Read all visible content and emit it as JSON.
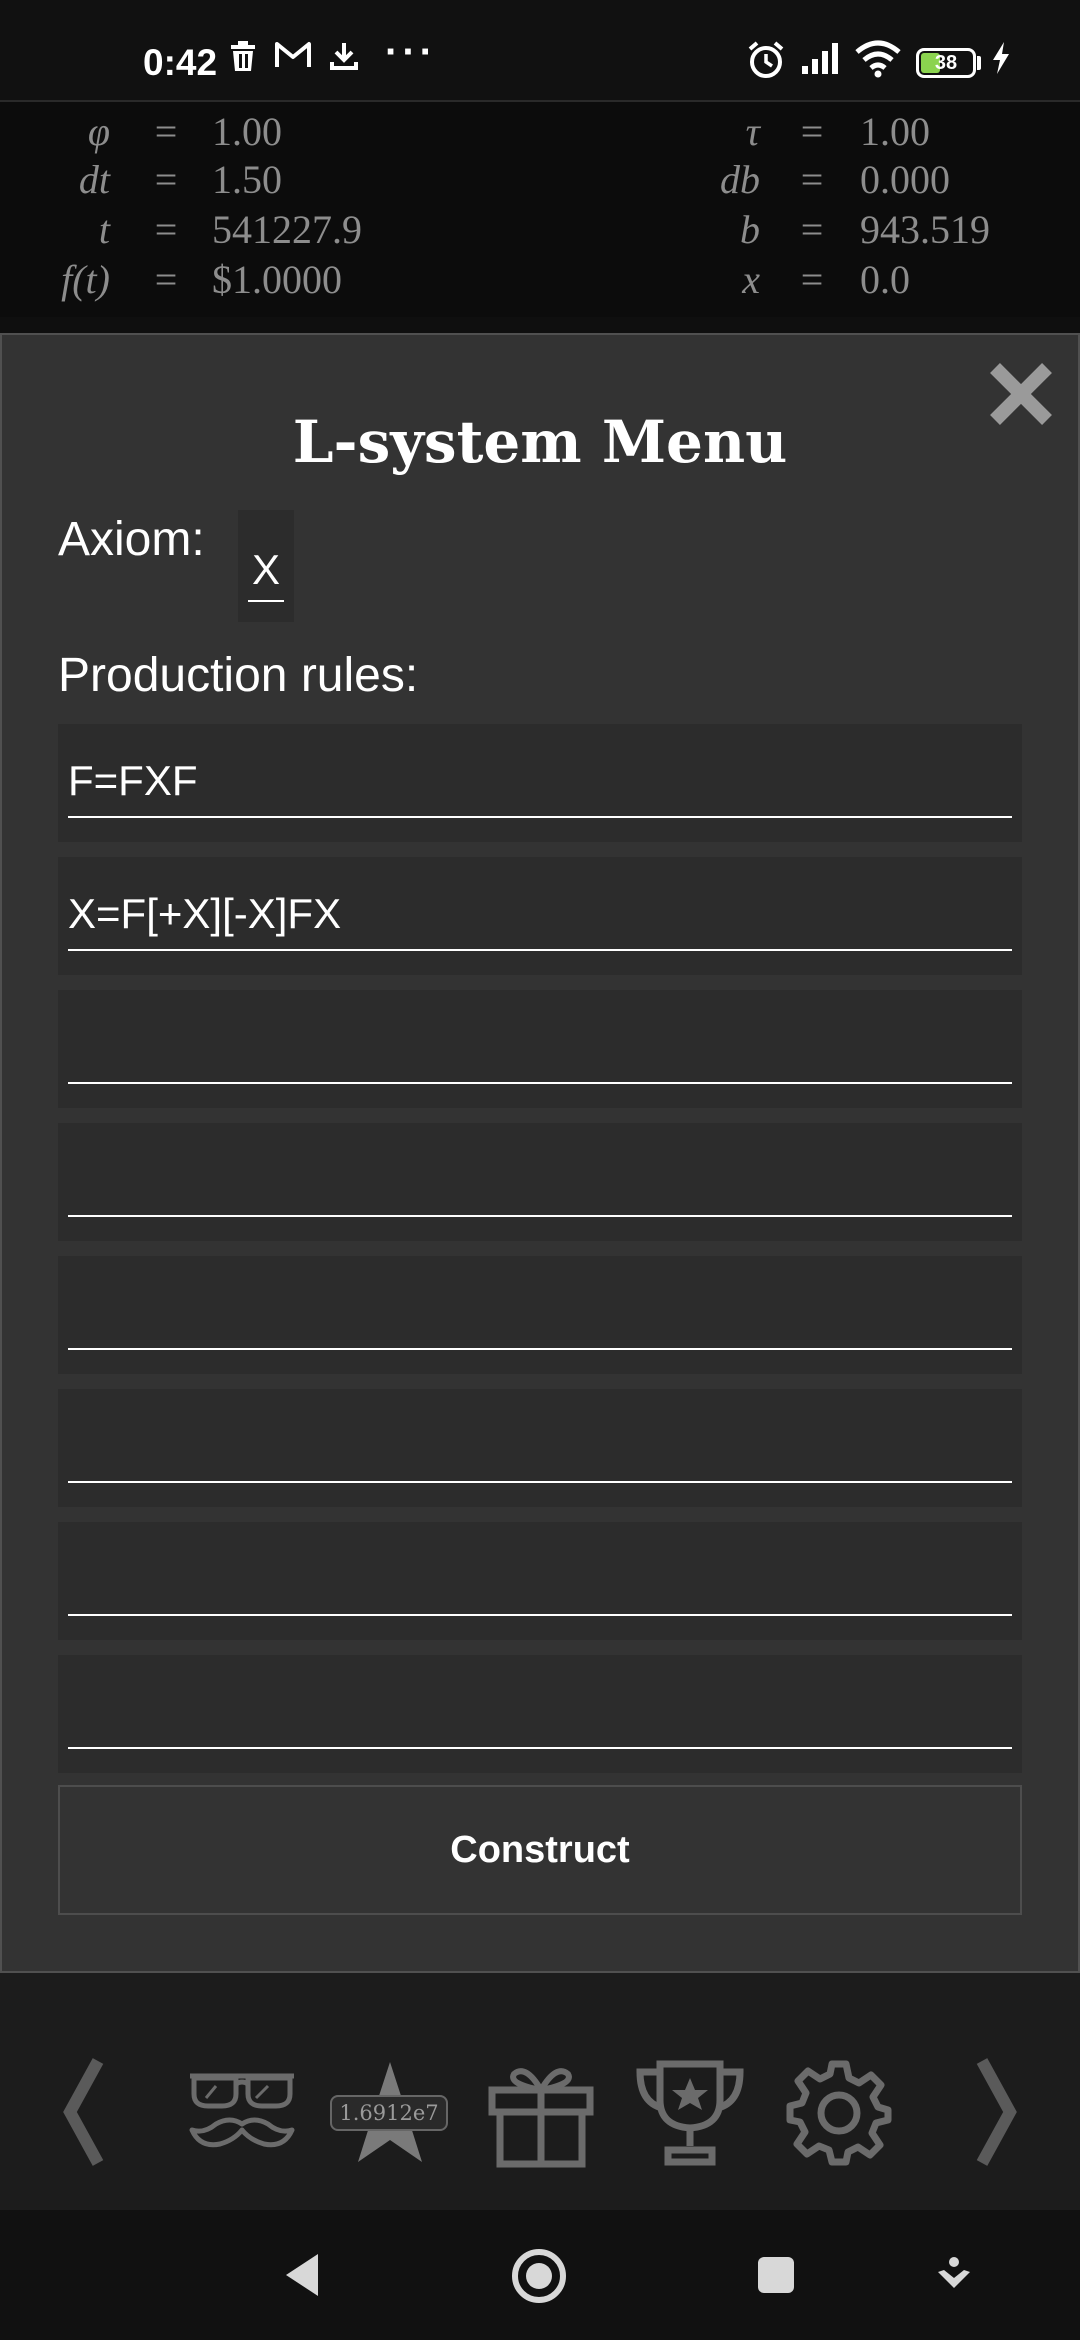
{
  "status_bar": {
    "time": "0:42",
    "left_icons": [
      "trash-icon",
      "gmail-icon",
      "download-icon",
      "more-dots-icon"
    ],
    "right_icons": [
      "alarm-icon",
      "signal-icon",
      "wifi-icon",
      "battery-icon",
      "charging-icon"
    ],
    "battery_level": "38",
    "more": "···"
  },
  "variables": {
    "left": [
      {
        "symbol": "φ",
        "eq": "=",
        "value": "1.00"
      },
      {
        "symbol": "dt",
        "eq": "=",
        "value": "1.50"
      },
      {
        "symbol": "t",
        "eq": "=",
        "value": "541227.9"
      },
      {
        "symbol": "f(t)",
        "eq": "=",
        "value": "$1.0000"
      }
    ],
    "right": [
      {
        "symbol": "τ",
        "eq": "=",
        "value": "1.00"
      },
      {
        "symbol": "db",
        "eq": "=",
        "value": "0.000"
      },
      {
        "symbol": "b",
        "eq": "=",
        "value": "943.519"
      },
      {
        "symbol": "x",
        "eq": "=",
        "value": "0.0"
      }
    ]
  },
  "dialog": {
    "title": "L-system Menu",
    "close_icon": "close-x-icon",
    "axiom_label": "Axiom:",
    "axiom_value": "X",
    "rules_label": "Production rules:",
    "rules": [
      "F=FXF",
      "X=F[+X][-X]FX",
      "",
      "",
      "",
      "",
      "",
      ""
    ],
    "construct_label": "Construct"
  },
  "toolbar": {
    "items": [
      "chevron-left-icon",
      "glasses-mustache-icon",
      "star-icon",
      "gift-icon",
      "trophy-icon",
      "gear-icon",
      "chevron-right-icon"
    ],
    "star_badge": "1.6912e7"
  },
  "nav_bar": {
    "items": [
      "back-icon",
      "home-icon",
      "recents-icon",
      "assist-icon"
    ]
  },
  "colors": {
    "background": "#0f0f0f",
    "dialog": "#333333",
    "field": "#2c2c2c",
    "muted_text": "#8d8d8d",
    "battery_fill": "#8bd34f",
    "toolbar_icon": "#6b6b6b"
  }
}
